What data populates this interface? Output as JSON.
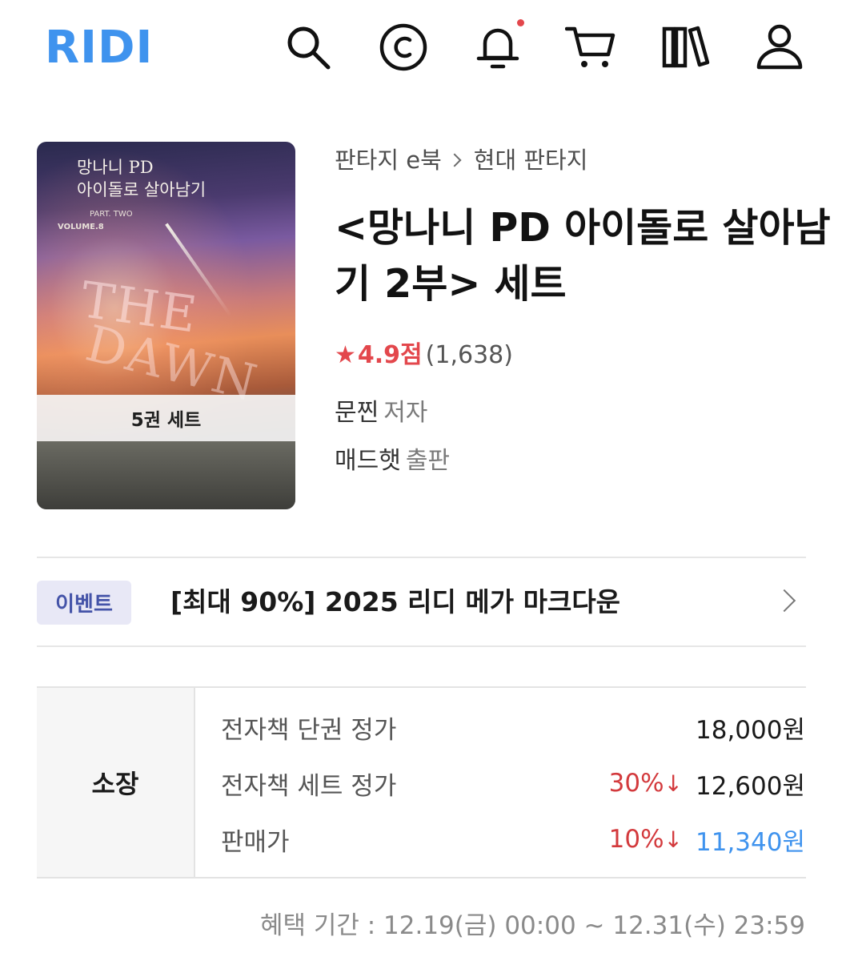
{
  "header": {
    "logo": "RIDI",
    "icons": [
      "search-icon",
      "cash-icon",
      "bell-icon",
      "cart-icon",
      "library-icon",
      "user-icon"
    ],
    "accent_color": "#3f93ee",
    "notification_dot_color": "#e3474c"
  },
  "book": {
    "cover": {
      "title_line1": "망나니 PD",
      "title_line2": "아이돌로 살아남기",
      "small_text": "PART. TWO",
      "volume_text": "VOLUME.8",
      "art_word1": "THE",
      "art_word2": "DAWN",
      "band_label": "5권 세트"
    },
    "breadcrumb": [
      "판타지 e북",
      "현대 판타지"
    ],
    "title": "<망나니 PD 아이돌로 살아남기 2부> 세트",
    "rating": {
      "score": "4.9점",
      "count": "(1,638)",
      "color": "#e3474c"
    },
    "author": {
      "name": "문찐",
      "role": "저자"
    },
    "publisher": {
      "name": "매드햇",
      "role": "출판"
    }
  },
  "event": {
    "badge": "이벤트",
    "text": "[최대 90%] 2025 리디 메가 마크다운"
  },
  "price": {
    "section_label": "소장",
    "rows": [
      {
        "label": "전자책 단권 정가",
        "discount": "",
        "price": "18,000원"
      },
      {
        "label": "전자책 세트 정가",
        "discount": "30%",
        "price": "12,600원"
      },
      {
        "label": "판매가",
        "discount": "10%",
        "price": "11,340원"
      }
    ],
    "discount_arrow": "↓",
    "discount_color": "#d33a3d",
    "final_price_color": "#3f93ee"
  },
  "benefit_period": "혜택 기간 : 12.19(금) 00:00 ~ 12.31(수) 23:59"
}
